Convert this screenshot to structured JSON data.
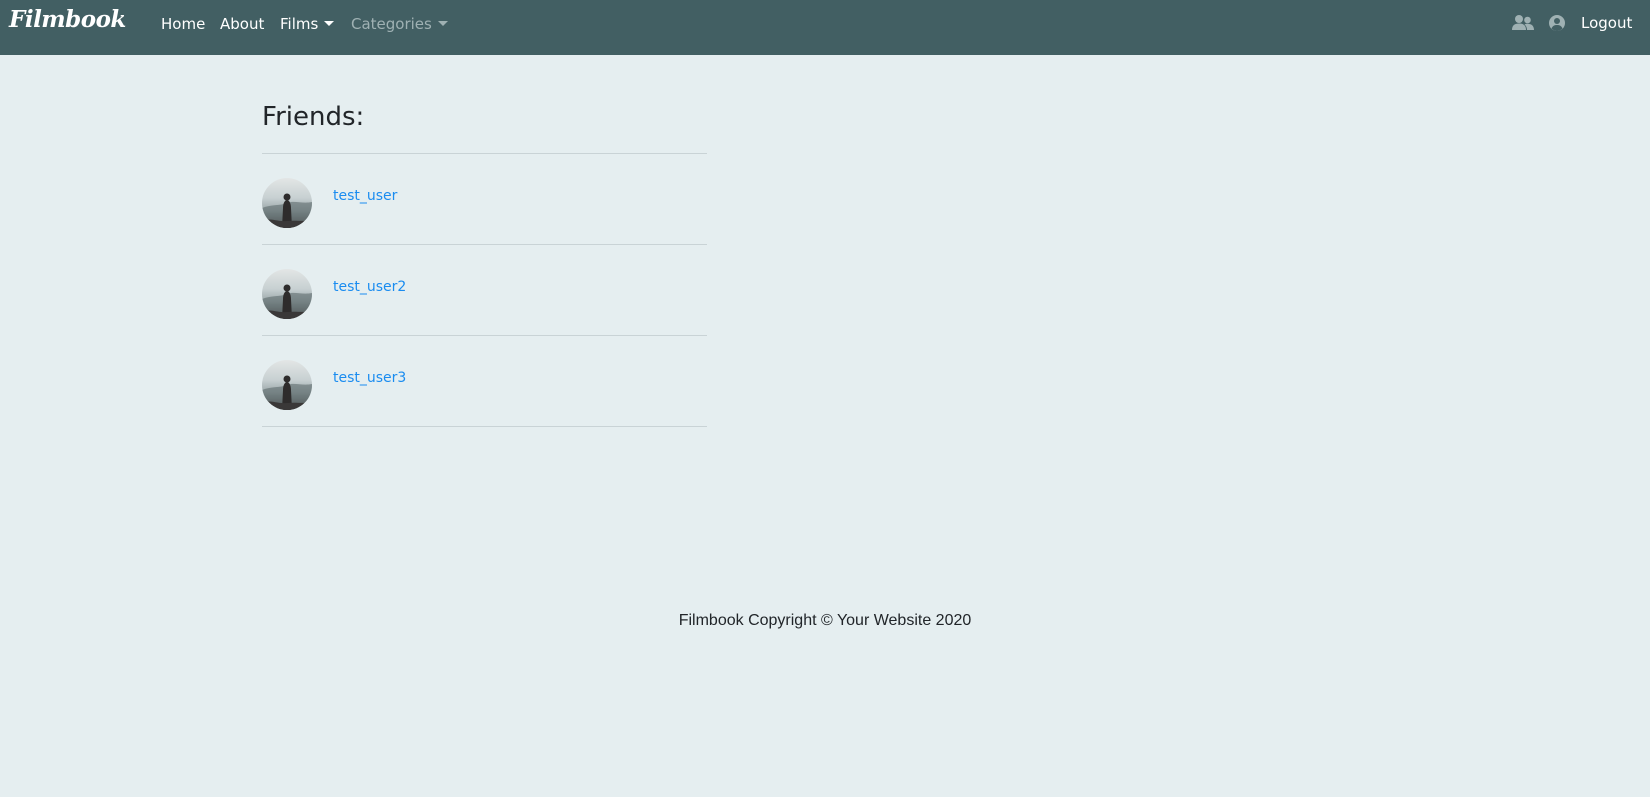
{
  "navbar": {
    "brand": "Filmbook",
    "links": {
      "home": "Home",
      "about": "About",
      "films": "Films",
      "categories": "Categories"
    },
    "icons": {
      "friends": "friends-icon",
      "user": "user-circle-icon"
    },
    "logout": "Logout",
    "colors": {
      "background": "#425f63",
      "text": "#ffffff",
      "muted": "#9fb1b3"
    }
  },
  "main": {
    "title": "Friends:",
    "friends": [
      {
        "name": "test_user"
      },
      {
        "name": "test_user2"
      },
      {
        "name": "test_user3"
      }
    ],
    "colors": {
      "background": "#e5eef0",
      "link": "#1a8cf0"
    }
  },
  "footer": {
    "text": "Filmbook Copyright © Your Website 2020"
  }
}
